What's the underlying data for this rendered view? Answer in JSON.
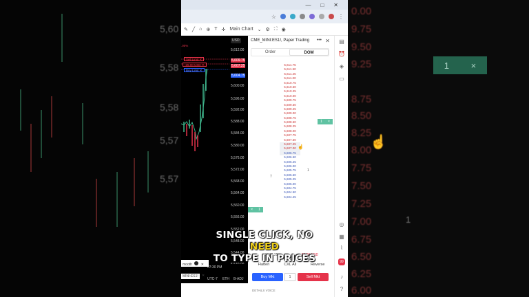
{
  "background_left": {
    "price_labels": [
      "5,60",
      "5,58",
      "5,58",
      "5,57",
      "5,57"
    ]
  },
  "background_right": {
    "price_labels": [
      "0.00",
      "9.75",
      "9.50",
      "9.25",
      "8.75",
      "8.50",
      "8.25",
      "8.00",
      "7.75",
      "7.50",
      "7.25",
      "7.00",
      "6.75",
      "6.50",
      "6.25",
      "6.00"
    ],
    "green_button_label": "1",
    "green_button_close": "×",
    "side_value": "1"
  },
  "browser": {
    "window_controls": [
      "—",
      "□",
      "✕"
    ]
  },
  "toolbar": {
    "layout_label": "Main Chart"
  },
  "chart": {
    "currency": "USD",
    "price_axis": [
      "5,612.00",
      "5,609.75",
      "5,607.25",
      "5,604.75",
      "5,600.00",
      "5,596.00",
      "5,592.00",
      "5,588.00",
      "5,584.00",
      "5,580.00",
      "5,576.00",
      "5,572.00",
      "5,568.00",
      "5,564.00",
      "5,560.00",
      "5,556.00",
      "5,552.00",
      "5,548.00",
      "5,544.00",
      "5,540.00"
    ],
    "order_labels": [
      {
        "text": "Sell Limit",
        "color": "#e5334a"
      },
      {
        "text": "-25.00 USD",
        "color": "#e5334a"
      },
      {
        "text": "Buy Limit",
        "color": "#2962ff"
      }
    ],
    "left_fragment": ".00%",
    "time_label": "07:30 PM",
    "bottom_items": [
      "UTC-7",
      "ETH",
      "B-ADJ"
    ],
    "symbol_fragment": "mooth",
    "bottom_symbol": "MINI:ES1!"
  },
  "panel": {
    "header": "CME_MINI:ES1!, Paper Trading",
    "more_label": "•••",
    "close_label": "✕",
    "tabs": [
      {
        "label": "Order"
      },
      {
        "label": "DOM"
      }
    ],
    "dom_prices": [
      "5,611.75",
      "5,611.50",
      "5,611.25",
      "5,611.00",
      "5,610.75",
      "5,610.50",
      "5,610.25",
      "5,610.00",
      "5,609.75",
      "5,609.50",
      "5,609.25",
      "5,609.00",
      "5,608.75",
      "5,608.50",
      "5,608.25",
      "5,608.00",
      "5,607.75",
      "5,607.50",
      "5,607.25",
      "5,607.00",
      "5,606.75",
      "5,606.50",
      "5,606.25",
      "5,606.00",
      "5,605.75",
      "5,605.50",
      "5,605.25",
      "5,605.00",
      "5,604.75",
      "5,604.50",
      "5,604.25"
    ],
    "dom_left_qty": "7",
    "dom_right_qty": "1",
    "green_order": {
      "qty": "1",
      "close": "×"
    },
    "green_order_left": {
      "qty": "1",
      "close": "×"
    },
    "footer_price": "5,607.25",
    "footer_pnl": "-25.00 USD",
    "actions": [
      "Flatten",
      "CXL All",
      "Reverse"
    ],
    "buy_label": "Buy Mkt",
    "qty_value": "1",
    "sell_label": "Sell Mkt",
    "details_label": "DETAILS  VOICE"
  },
  "caption": {
    "line1_a": "SINGLE CLICK, NO ",
    "line1_hl": "NEED",
    "line2": "TO TYPE IN PRICES"
  },
  "colors": {
    "buy": "#2962ff",
    "sell": "#e5334a",
    "green": "#5fc2a2",
    "highlight": "#f2d21b"
  }
}
